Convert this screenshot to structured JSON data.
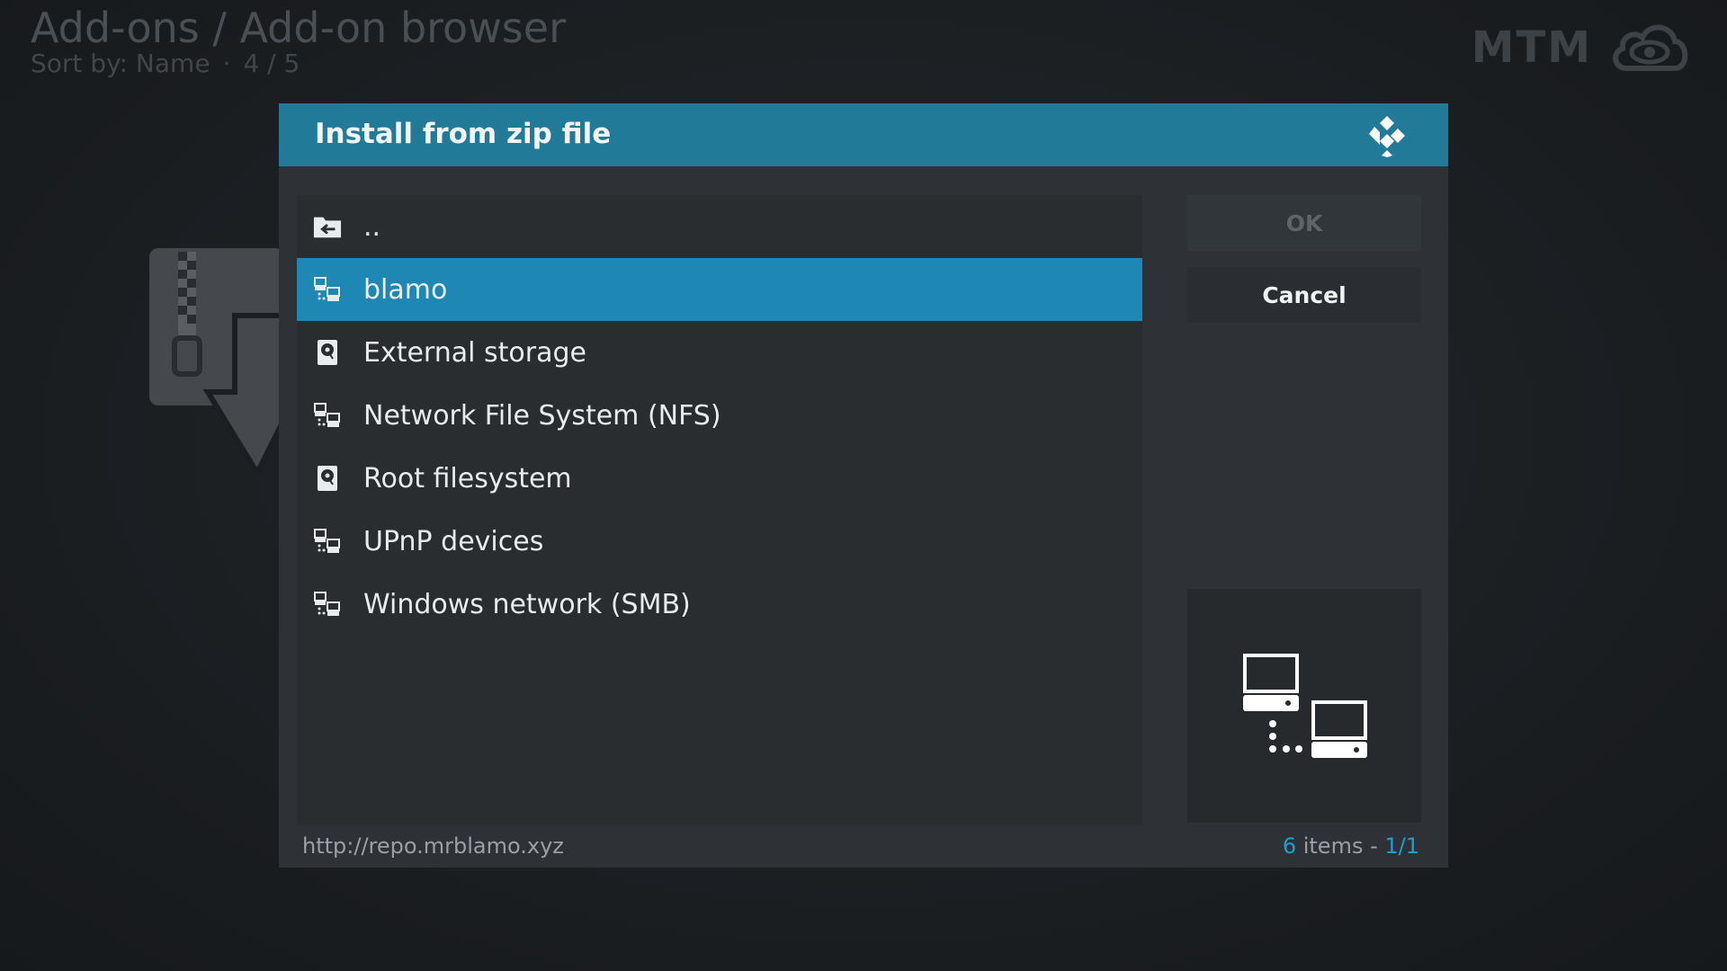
{
  "header": {
    "title": "Add-ons / Add-on browser",
    "sort_label": "Sort by: Name",
    "dot": "·",
    "position": "4 / 5"
  },
  "brand": {
    "text": "MTM",
    "icon": "cloud-eye-icon"
  },
  "dialog": {
    "title": "Install from zip file",
    "logo_icon": "kodi-logo-icon",
    "items": [
      {
        "label": "..",
        "icon": "folder-back-icon",
        "selected": false
      },
      {
        "label": "blamo",
        "icon": "network-icon",
        "selected": true
      },
      {
        "label": "External storage",
        "icon": "hard-drive-icon",
        "selected": false
      },
      {
        "label": "Network File System (NFS)",
        "icon": "network-icon",
        "selected": false
      },
      {
        "label": "Root filesystem",
        "icon": "hard-drive-icon",
        "selected": false
      },
      {
        "label": "UPnP devices",
        "icon": "network-icon",
        "selected": false
      },
      {
        "label": "Windows network (SMB)",
        "icon": "network-icon",
        "selected": false
      }
    ],
    "buttons": {
      "ok": "OK",
      "cancel": "Cancel"
    },
    "preview_icon": "network-large-icon",
    "footer": {
      "path": "http://repo.mrblamo.xyz",
      "count_number": "6",
      "count_word": " items - ",
      "page": "1/1"
    }
  },
  "colors": {
    "header_bar": "#227a99",
    "selected_item": "#1f87b3",
    "accent_text": "#1f9ed0"
  }
}
